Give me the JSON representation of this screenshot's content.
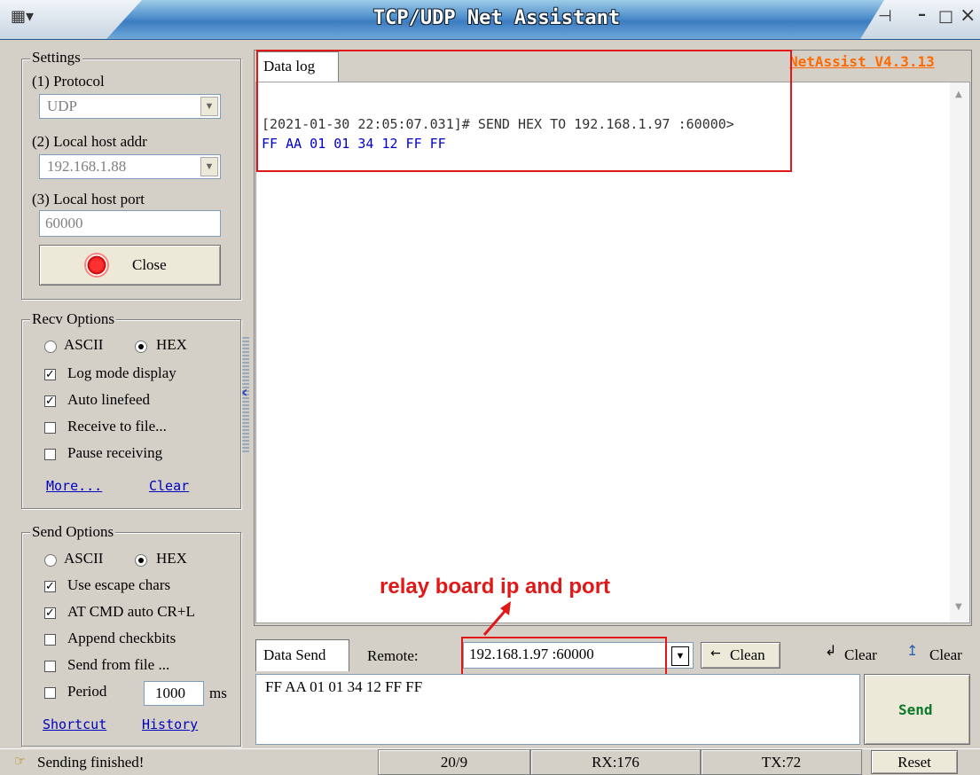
{
  "window": {
    "title": "TCP/UDP Net Assistant",
    "version": "NetAssist V4.3.13",
    "min_label": "–",
    "max_label": "□",
    "close_label": "×"
  },
  "settings": {
    "group_title": "Settings",
    "protocol_label": "(1) Protocol",
    "protocol_value": "UDP",
    "host_addr_label": "(2) Local host addr",
    "host_addr_value": "192.168.1.88",
    "host_port_label": "(3) Local host port",
    "host_port_value": "60000",
    "close_button": "Close"
  },
  "recv_options": {
    "group_title": "Recv Options",
    "ascii_label": "ASCII",
    "hex_label": "HEX",
    "mode": "HEX",
    "log_mode": {
      "label": "Log mode display",
      "checked": true
    },
    "auto_linefeed": {
      "label": "Auto linefeed",
      "checked": true
    },
    "receive_to_file": {
      "label": "Receive to file...",
      "checked": false
    },
    "pause_receiving": {
      "label": "Pause receiving",
      "checked": false
    },
    "more_link": "More...",
    "clear_link": "Clear"
  },
  "send_options": {
    "group_title": "Send Options",
    "ascii_label": "ASCII",
    "hex_label": "HEX",
    "mode": "HEX",
    "escape_chars": {
      "label": "Use escape chars",
      "checked": true
    },
    "at_cmd": {
      "label": "AT CMD auto CR+L",
      "checked": true
    },
    "append_checkbits": {
      "label": "Append checkbits",
      "checked": false
    },
    "send_from_file": {
      "label": "Send from file ...",
      "checked": false
    },
    "period": {
      "label": "Period",
      "checked": false
    },
    "period_value": "1000",
    "period_unit": "ms",
    "shortcut_link": "Shortcut",
    "history_link": "History"
  },
  "data_log": {
    "tab_label": "Data log",
    "line1": "[2021-01-30 22:05:07.031]# SEND HEX TO 192.168.1.97 :60000>",
    "line2": "FF AA 01 01 34 12 FF FF"
  },
  "annotation": {
    "text": "relay board ip and port"
  },
  "send_bar": {
    "tab_label": "Data Send",
    "remote_label": "Remote:",
    "remote_value": "192.168.1.97 :60000",
    "clean_button": "Clean",
    "clear_button_1": "Clear",
    "clear_button_2": "Clear",
    "send_text": "FF AA 01 01 34 12 FF FF",
    "send_button": "Send"
  },
  "status_bar": {
    "message": "Sending finished!",
    "counter": "20/9",
    "rx": "RX:176",
    "tx": "TX:72",
    "reset_button": "Reset"
  },
  "colors": {
    "accent_orange": "#ff6a00",
    "log_blue": "#0000cc",
    "annotation_red": "#e01818",
    "send_green": "#0a7a2a"
  }
}
